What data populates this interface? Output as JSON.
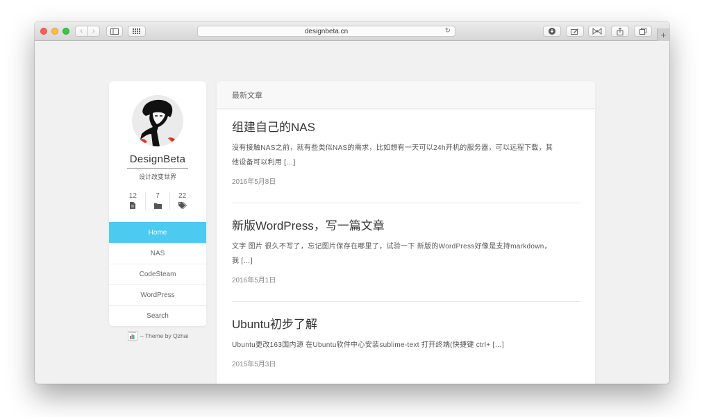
{
  "browser": {
    "url": "designbeta.cn",
    "back_glyph": "‹",
    "forward_glyph": "›",
    "new_tab_glyph": "+"
  },
  "sidebar": {
    "site_name": "DesignBeta",
    "tagline": "设计改变世界",
    "stats": [
      {
        "count": "12",
        "icon": "file-icon"
      },
      {
        "count": "7",
        "icon": "folder-icon"
      },
      {
        "count": "22",
        "icon": "tags-icon"
      }
    ],
    "menu": [
      "Home",
      "NAS",
      "CodeSteam",
      "WordPress",
      "Search"
    ],
    "active_menu": "Home",
    "accent_color": "#4ccaf0",
    "credit": "– Theme by Qzhai"
  },
  "main": {
    "header": "最新文章",
    "posts": [
      {
        "title": "组建自己的NAS",
        "excerpt_lines": [
          "没有接触NAS之前，就有些类似NAS的需求，比如想有一天可以24h开机的服务器，可以远程下载，其",
          "他设备可以利用 […]"
        ],
        "date": "2016年5月8日"
      },
      {
        "title": "新版WordPress，写一篇文章",
        "excerpt_lines": [
          "文字 图片 很久不写了，忘记图片保存在哪里了，试验一下 新版的WordPress好像是支持markdown，",
          "我 […]"
        ],
        "date": "2016年5月1日"
      },
      {
        "title": "Ubuntu初步了解",
        "excerpt_lines": [
          "Ubuntu更改163国内源 在Ubuntu软件中心安装sublime-text 打开终端(快捷键 ctrl+ […]"
        ],
        "date": "2015年5月3日"
      }
    ]
  }
}
